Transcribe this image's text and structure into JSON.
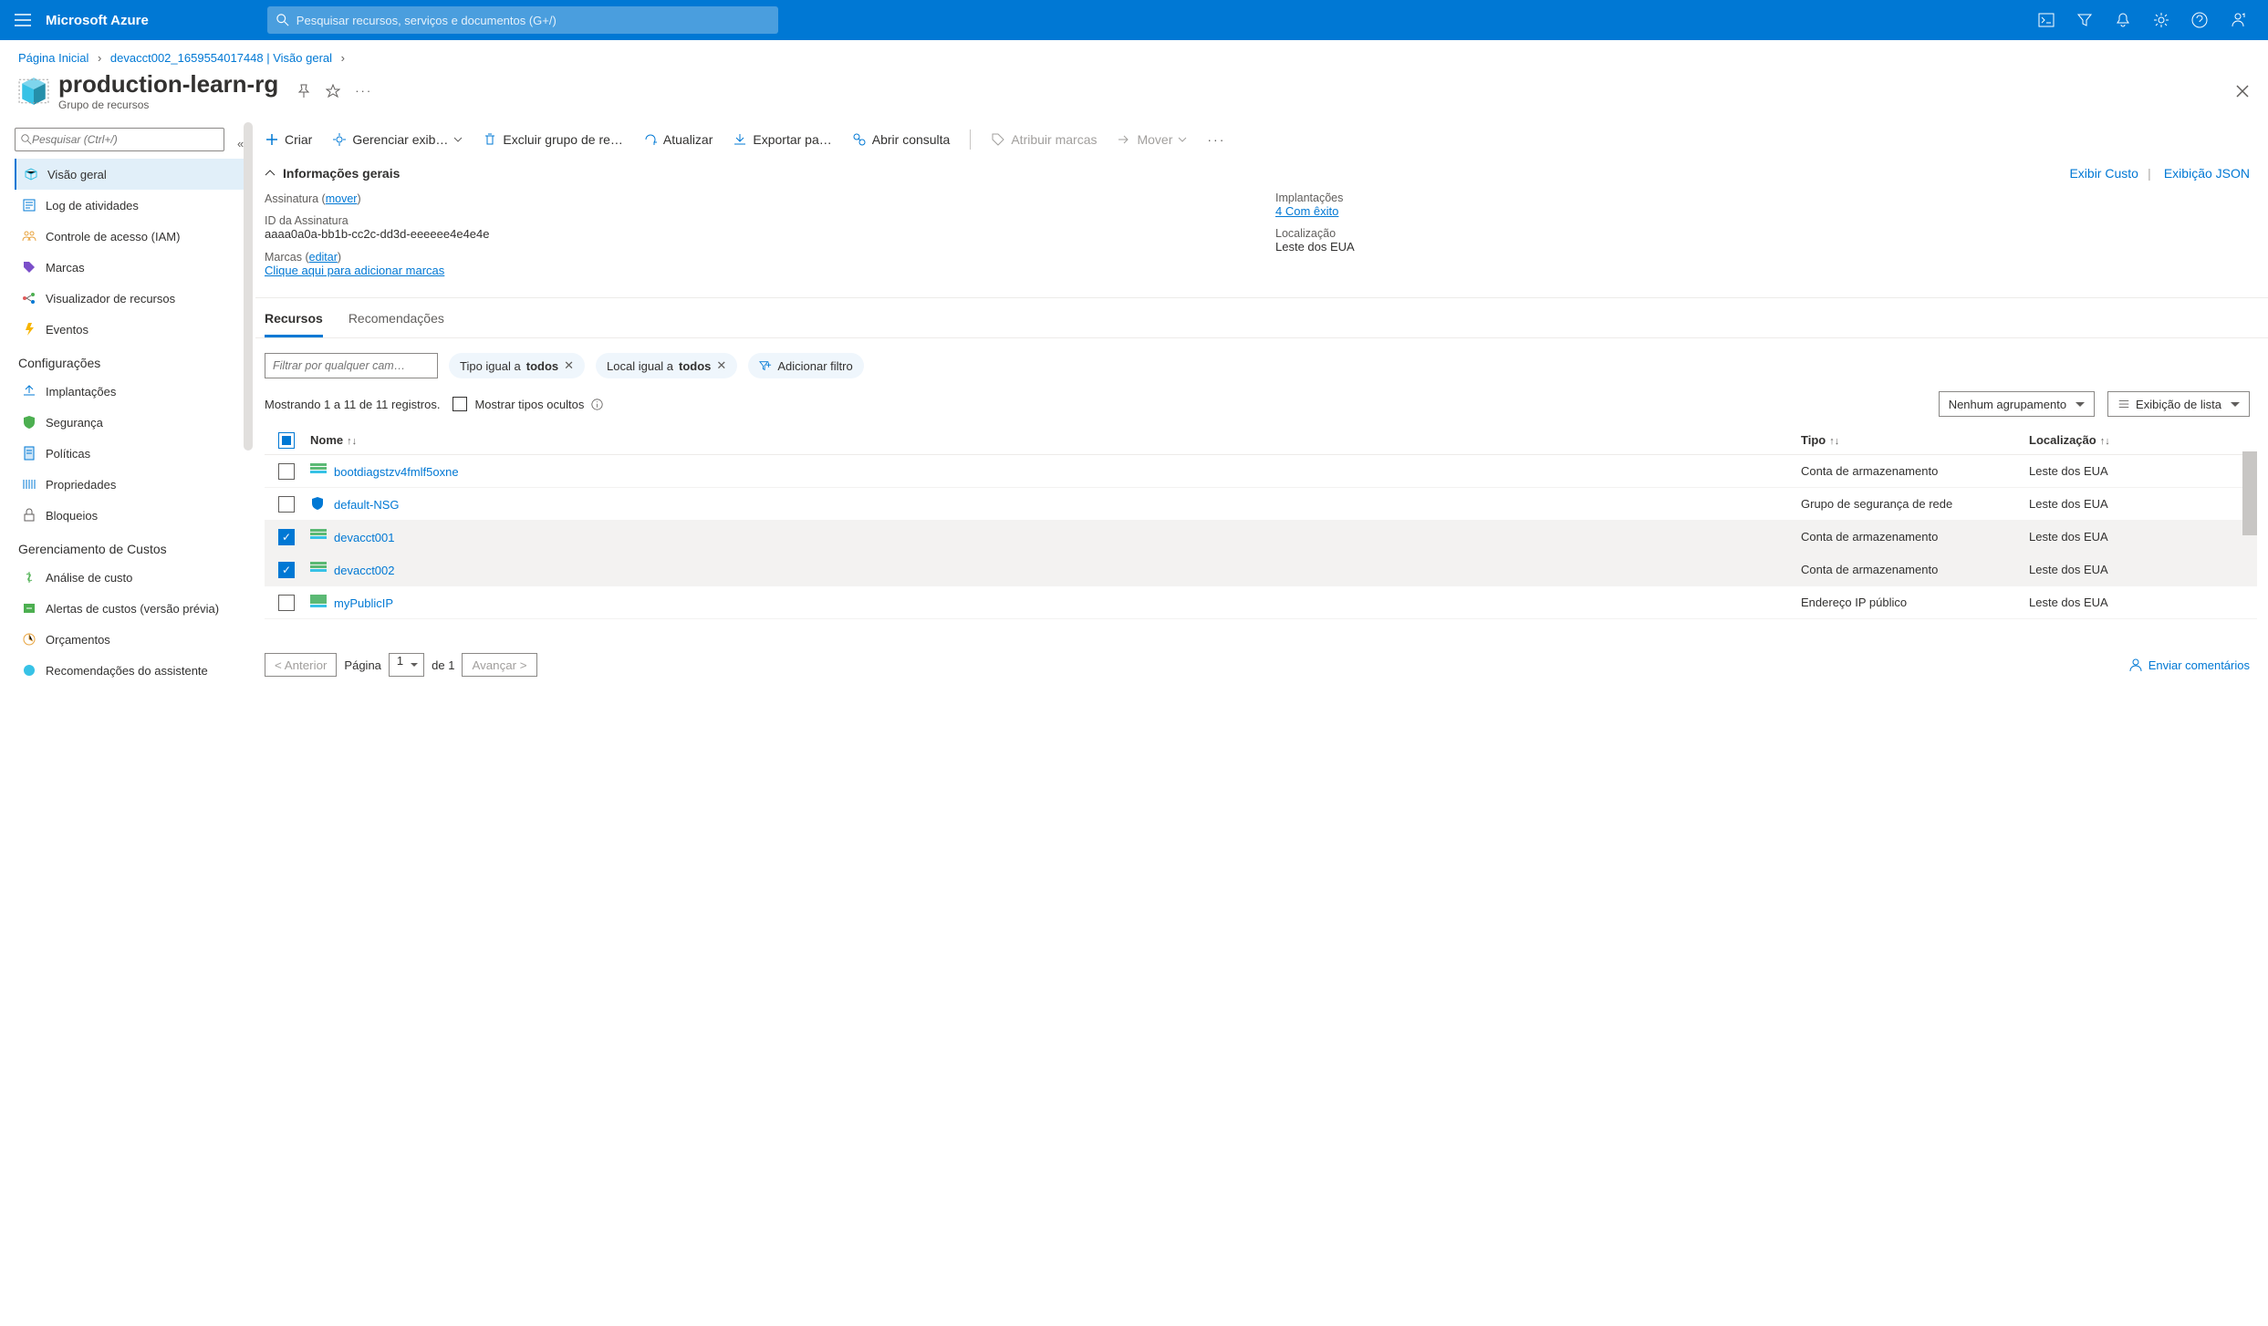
{
  "topbar": {
    "brand": "Microsoft Azure",
    "search_placeholder": "Pesquisar recursos, serviços e documentos (G+/)"
  },
  "breadcrumb": {
    "home": "Página Inicial",
    "path": "devacct002_1659554017448 | Visão geral"
  },
  "title": {
    "name": "production-learn-rg",
    "subtitle": "Grupo de recursos"
  },
  "sidebar": {
    "search_placeholder": "Pesquisar (Ctrl+/)",
    "items_top": [
      "Visão geral",
      "Log de atividades",
      "Controle de acesso (IAM)",
      "Marcas",
      "Visualizador de recursos",
      "Eventos"
    ],
    "header_settings": "Configurações",
    "items_settings": [
      "Implantações",
      "Segurança",
      "Políticas",
      "Propriedades",
      "Bloqueios"
    ],
    "header_cost": "Gerenciamento de Custos",
    "items_cost": [
      "Análise de custo",
      "Alertas de custos (versão prévia)",
      "Orçamentos",
      "Recomendações do assistente"
    ]
  },
  "commands": {
    "create": "Criar",
    "manage_view": "Gerenciar exib…",
    "delete_rg": "Excluir grupo de re…",
    "refresh": "Atualizar",
    "export": "Exportar pa…",
    "open_query": "Abrir consulta",
    "assign_tags": "Atribuir marcas",
    "move": "Mover"
  },
  "essentials": {
    "header": "Informações gerais",
    "view_cost": "Exibir Custo",
    "json_view": "Exibição JSON",
    "subscription_label": "Assinatura",
    "subscription_move": "mover",
    "sub_id_label": "ID da Assinatura",
    "sub_id_value": "aaaa0a0a-bb1b-cc2c-dd3d-eeeeee4e4e4e",
    "tags_label": "Marcas",
    "tags_edit": "editar",
    "tags_add": "Clique aqui para adicionar marcas",
    "deployments_label": "Implantações",
    "deployments_value": "4 Com êxito",
    "location_label": "Localização",
    "location_value": "Leste dos EUA"
  },
  "tabs": {
    "resources": "Recursos",
    "recommendations": "Recomendações"
  },
  "filters": {
    "input_placeholder": "Filtrar por qualquer cam…",
    "type_prefix": "Tipo igual a ",
    "type_value": "todos",
    "loc_prefix": "Local igual a ",
    "loc_value": "todos",
    "add_filter": "Adicionar filtro"
  },
  "status": {
    "showing": "Mostrando 1 a 11 de 11 registros.",
    "show_hidden": "Mostrar tipos ocultos",
    "group_none": "Nenhum agrupamento",
    "list_view": "Exibição de lista"
  },
  "table": {
    "col_name": "Nome",
    "col_type": "Tipo",
    "col_loc": "Localização",
    "rows": [
      {
        "name": "bootdiagstzv4fmlf5oxne",
        "type": "Conta de armazenamento",
        "loc": "Leste dos EUA",
        "selected": false,
        "icon": "storage"
      },
      {
        "name": "default-NSG",
        "type": "Grupo de segurança de rede",
        "loc": "Leste dos EUA",
        "selected": false,
        "icon": "shield"
      },
      {
        "name": "devacct001",
        "type": "Conta de armazenamento",
        "loc": "Leste dos EUA",
        "selected": true,
        "icon": "storage"
      },
      {
        "name": "devacct002",
        "type": "Conta de armazenamento",
        "loc": "Leste dos EUA",
        "selected": true,
        "icon": "storage"
      },
      {
        "name": "myPublicIP",
        "type": "Endereço IP público",
        "loc": "Leste dos EUA",
        "selected": false,
        "icon": "ip"
      }
    ]
  },
  "pager": {
    "prev": "< Anterior",
    "page_label": "Página",
    "page_current": "1",
    "of": "de 1",
    "next": "Avançar >",
    "feedback": "Enviar comentários"
  }
}
